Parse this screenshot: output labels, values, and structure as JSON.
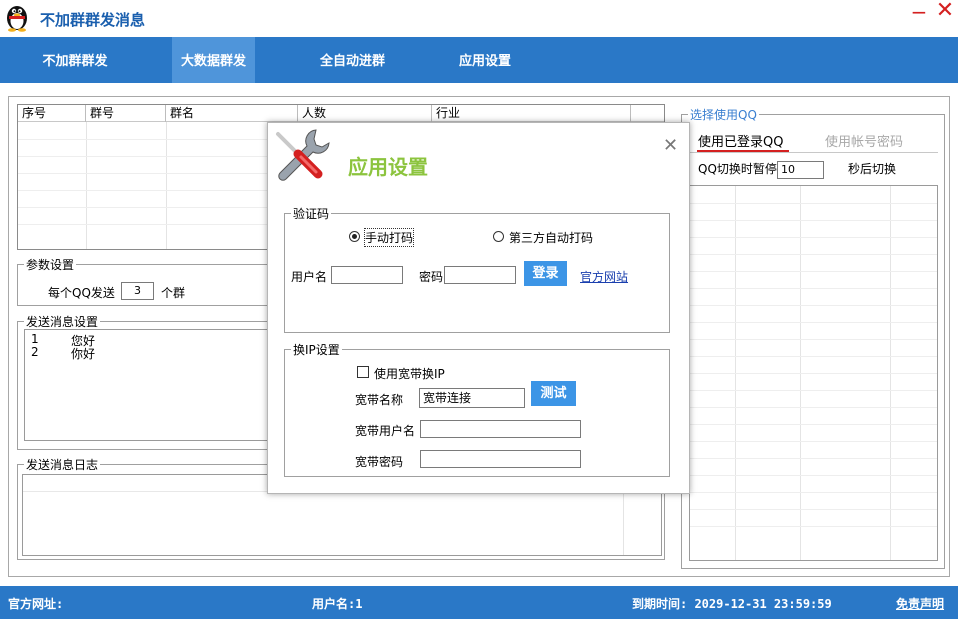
{
  "window": {
    "title": "不加群群发消息",
    "minimize_glyph": "−",
    "close_glyph": "✕",
    "app_icon": "qq-penguin-icon"
  },
  "nav": {
    "tabs": [
      {
        "label": "不加群群发",
        "active": false
      },
      {
        "label": "大数据群发",
        "active": true
      },
      {
        "label": "全自动进群",
        "active": false
      },
      {
        "label": "应用设置",
        "active": false
      }
    ]
  },
  "group_table": {
    "columns": [
      "序号",
      "群号",
      "群名",
      "人数",
      "行业"
    ]
  },
  "params": {
    "legend": "参数设置",
    "per_qq_prefix": "每个QQ发送",
    "per_qq_value": "3",
    "per_qq_suffix": "个群"
  },
  "messages": {
    "legend": "发送消息设置",
    "rows": [
      {
        "num": "1",
        "text": "您好"
      },
      {
        "num": "2",
        "text": "你好"
      }
    ]
  },
  "log": {
    "legend": "发送消息日志"
  },
  "qq_panel": {
    "legend": "选择使用QQ",
    "tab_logged_in": "使用已登录QQ",
    "tab_password": "使用帐号密码",
    "switch_prefix": "QQ切换时暂停",
    "switch_value": "10",
    "switch_suffix": "秒后切换"
  },
  "dialog": {
    "title": "应用设置",
    "close_glyph": "✕",
    "icon": "tools-icon",
    "captcha": {
      "legend": "验证码",
      "manual_label": "手动打码",
      "manual_selected": true,
      "third_party_label": "第三方自动打码",
      "username_label": "用户名",
      "username_value": "",
      "password_label": "密码",
      "password_value": "",
      "login_button": "登录",
      "official_site_link": "官方网站"
    },
    "ip": {
      "legend": "换IP设置",
      "use_broadband_label": "使用宽带换IP",
      "use_broadband_checked": false,
      "broadband_name_label": "宽带名称",
      "broadband_name_value": "宽带连接",
      "test_button": "测试",
      "broadband_user_label": "宽带用户名",
      "broadband_user_value": "",
      "broadband_password_label": "宽带密码",
      "broadband_password_value": ""
    }
  },
  "status": {
    "website_label": "官方网址:",
    "username_text": "用户名:1",
    "expiry_text": "到期时间: 2029-12-31 23:59:59",
    "disclaimer_link": "免责声明"
  },
  "colors": {
    "nav_bg": "#2a78c7",
    "nav_active": "#4f95da",
    "title_blue": "#1a5fae",
    "close_red": "#d42020",
    "dialog_title": "#8cc43e",
    "tab_underline": "#d42020"
  }
}
